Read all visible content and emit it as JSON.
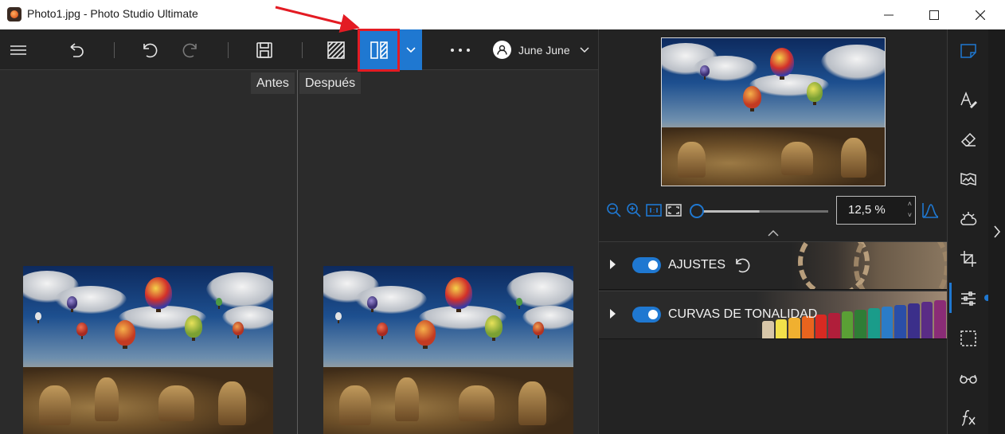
{
  "window": {
    "title": "Photo1.jpg - Photo Studio Ultimate"
  },
  "toolbar": {
    "user_name": "June June"
  },
  "canvas": {
    "before_label": "Antes",
    "after_label": "Después"
  },
  "zoom": {
    "value": "12,5 %",
    "slider_fraction": 0.48
  },
  "sections": [
    {
      "label": "AJUSTES",
      "enabled": true
    },
    {
      "label": "CURVAS DE TONALIDAD",
      "enabled": true
    }
  ],
  "icons": {
    "menu": "hamburger-icon",
    "undo_all": "undo-all-icon",
    "undo": "undo-icon",
    "redo": "redo-icon",
    "save": "save-icon",
    "single_view": "single-view-icon",
    "split_view": "split-view-icon",
    "more": "more-icon",
    "user": "user-icon"
  },
  "colors": {
    "accent": "#1f78d1",
    "highlight": "#e31b23"
  }
}
